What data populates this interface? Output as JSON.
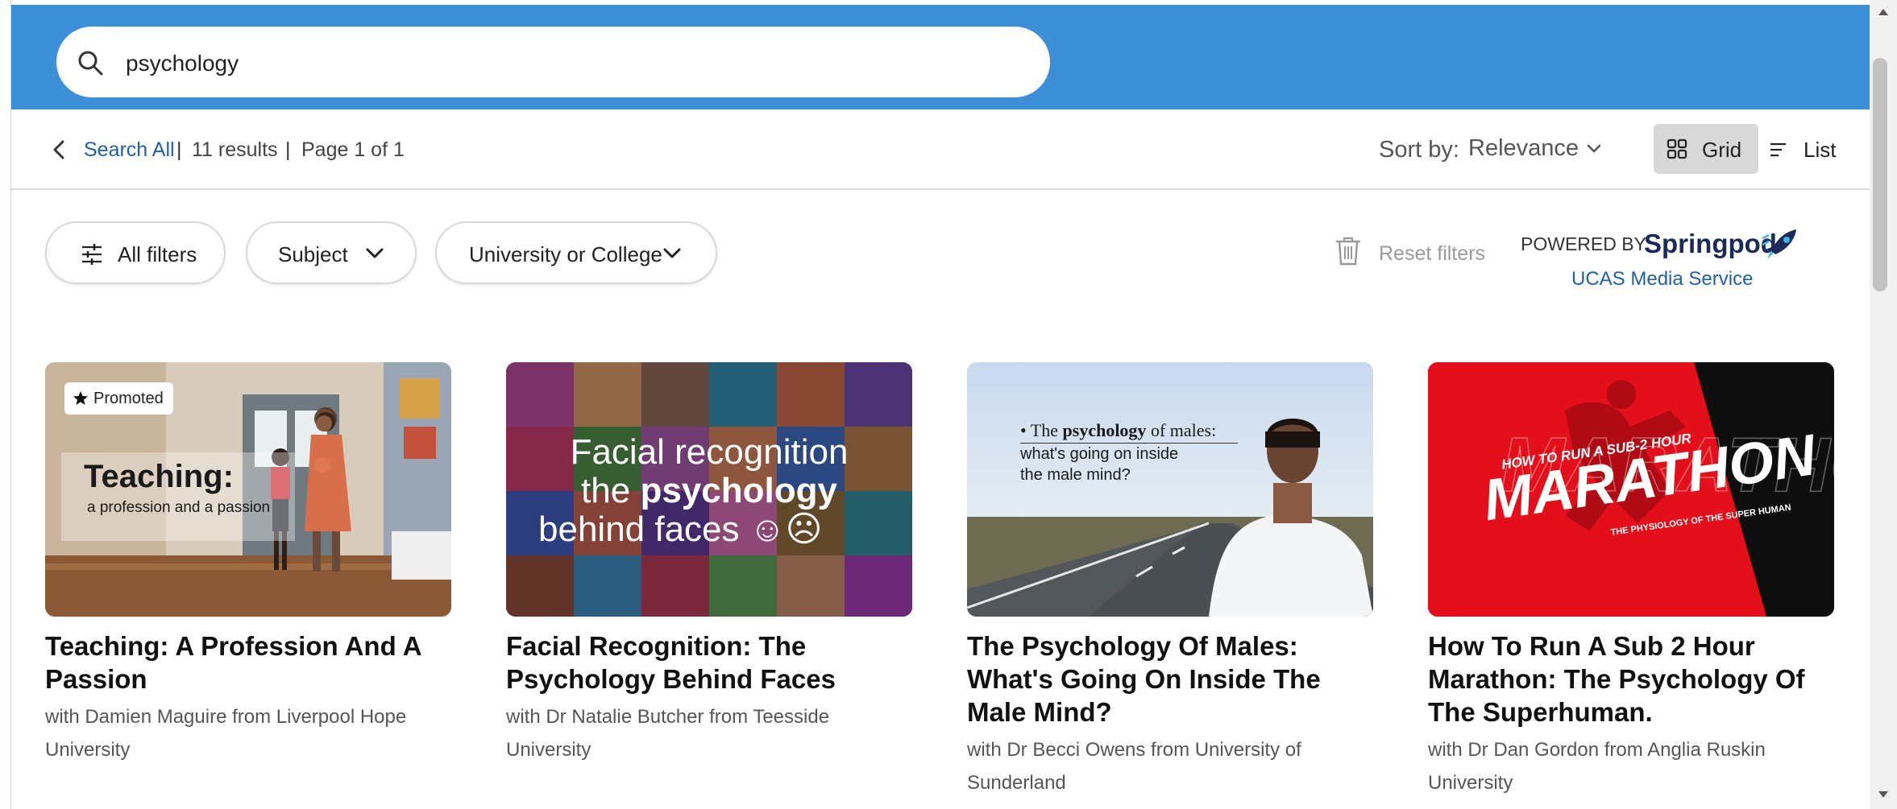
{
  "search": {
    "query": "psychology"
  },
  "toolbar": {
    "back_label": "Search All",
    "results": "11 results",
    "page": "Page 1 of 1",
    "separator": "|",
    "sort_label": "Sort by:",
    "sort_value": "Relevance",
    "view_grid": "Grid",
    "view_list": "List"
  },
  "filters": {
    "all_filters": "All filters",
    "subject": "Subject",
    "university": "University or College",
    "reset": "Reset filters"
  },
  "branding": {
    "powered_by": "POWERED BY",
    "brand": "Springpod",
    "ucas": "UCAS Media Service"
  },
  "cards": [
    {
      "badge": "Promoted",
      "title": "Teaching: A Profession And A Passion",
      "subtitle": "with Damien Maguire from Liverpool Hope University",
      "thumb_title": "Teaching:",
      "thumb_sub": "a profession and a passion"
    },
    {
      "title": "Facial Recognition: The Psychology Behind Faces",
      "subtitle": "with Dr Natalie Butcher from Teesside University",
      "thumb_line1": "Facial recognition",
      "thumb_line2a": "the ",
      "thumb_line2b": "psychology",
      "thumb_line3": "behind faces ☺☹"
    },
    {
      "title": "The Psychology Of Males: What's Going On Inside The Male Mind?",
      "subtitle": "with Dr Becci Owens from University of Sunderland",
      "thumb_line1a": "• The ",
      "thumb_line1b": "psychology",
      "thumb_line1c": " of males:",
      "thumb_line2": "what's going on inside",
      "thumb_line3": "the male mind?"
    },
    {
      "title": "How To Run A Sub 2 Hour Marathon: The Psychology Of The Superhuman.",
      "subtitle": "with Dr Dan Gordon from Anglia Ruskin University",
      "thumb_top": "HOW TO RUN A SUB-2 HOUR",
      "thumb_main": "MARATHON",
      "thumb_bottom": "THE PHYSIOLOGY OF THE SUPER HUMAN"
    }
  ],
  "colors": {
    "header": "#3d8fd8",
    "link": "#2160a8",
    "marathon_red": "#e3101c"
  }
}
